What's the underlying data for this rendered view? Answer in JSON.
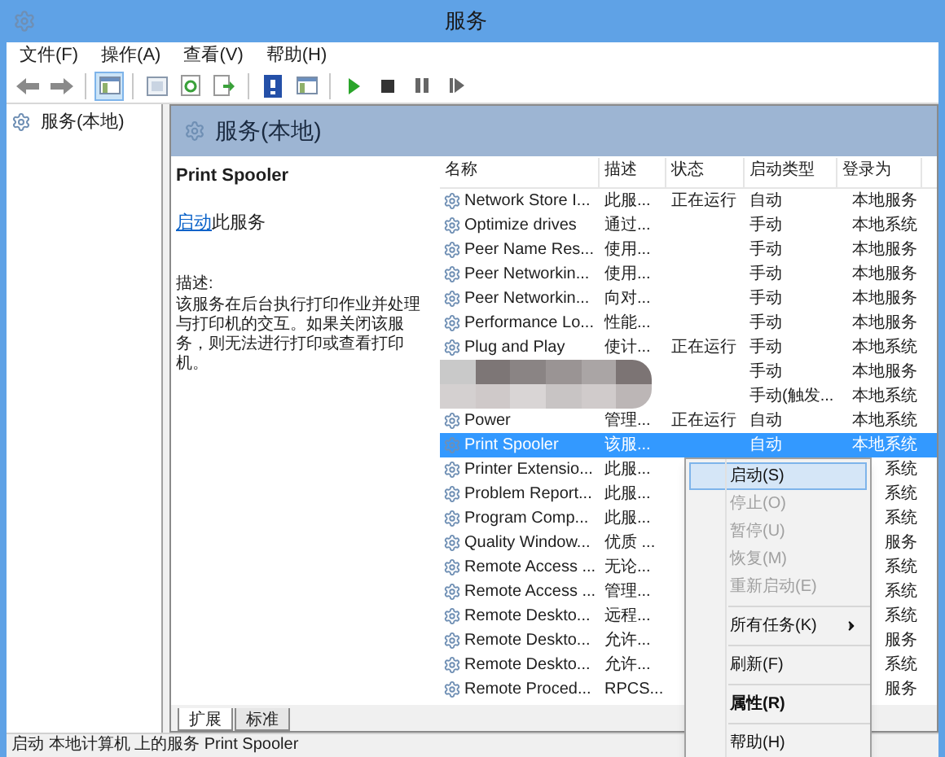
{
  "window": {
    "title": "服务"
  },
  "menu_bar": [
    "文件(F)",
    "操作(A)",
    "查看(V)",
    "帮助(H)"
  ],
  "toolbar": [
    {
      "kind": "back"
    },
    {
      "kind": "forward"
    },
    {
      "kind": "sep"
    },
    {
      "kind": "tree",
      "selected": true
    },
    {
      "kind": "sep"
    },
    {
      "kind": "props"
    },
    {
      "kind": "refresh"
    },
    {
      "kind": "export"
    },
    {
      "kind": "sep"
    },
    {
      "kind": "help"
    },
    {
      "kind": "console",
      "selected": false
    },
    {
      "kind": "sep"
    },
    {
      "kind": "play"
    },
    {
      "kind": "stop"
    },
    {
      "kind": "pause"
    },
    {
      "kind": "restart"
    }
  ],
  "tree": {
    "items": [
      {
        "label": "服务(本地)",
        "selected": false
      }
    ]
  },
  "panel": {
    "title": "服务(本地)"
  },
  "details": {
    "name": "Print Spooler",
    "action_link": "启动",
    "action_rest": "此服务",
    "description_label": "描述:",
    "description": "该服务在后台执行打印作业并处理与打印机的交互。如果关闭该服务，则无法进行打印或查看打印机。"
  },
  "table": {
    "columns": [
      "名称",
      "描述",
      "状态",
      "启动类型",
      "登录为"
    ],
    "rows": [
      {
        "name": "Network Store I...",
        "desc": "此服...",
        "status": "正在运行",
        "startup": "自动",
        "login": "本地服务",
        "selected": false
      },
      {
        "name": "Optimize drives",
        "desc": "通过...",
        "startup": "手动",
        "login": "本地系统",
        "selected": false
      },
      {
        "name": "Peer Name Res...",
        "desc": "使用...",
        "startup": "手动",
        "login": "本地服务",
        "selected": false
      },
      {
        "name": "Peer Networkin...",
        "desc": "使用...",
        "startup": "手动",
        "login": "本地服务",
        "selected": false
      },
      {
        "name": "Peer Networkin...",
        "desc": "向对...",
        "startup": "手动",
        "login": "本地服务",
        "selected": false
      },
      {
        "name": "Performance Lo...",
        "desc": "性能...",
        "startup": "手动",
        "login": "本地服务",
        "selected": false
      },
      {
        "name": "Plug and Play",
        "desc": "使计...",
        "status": "正在运行",
        "startup": "手动",
        "login": "本地系统",
        "selected": false
      },
      {
        "startup": "手动",
        "login": "本地服务",
        "selected": false
      },
      {
        "startup": "手动(触发...",
        "login": "本地系统",
        "selected": false
      },
      {
        "name": "Power",
        "desc": "管理...",
        "status": "正在运行",
        "startup": "自动",
        "login": "本地系统",
        "selected": false
      },
      {
        "name": "Print Spooler",
        "desc": "该服...",
        "startup": "自动",
        "login": "本地系统",
        "selected": true
      },
      {
        "name": "Printer Extensio...",
        "desc": "此服...",
        "login": "系统",
        "selected": false
      },
      {
        "name": "Problem Report...",
        "desc": "此服...",
        "login": "系统",
        "selected": false
      },
      {
        "name": "Program Comp...",
        "desc": "此服...",
        "login": "系统",
        "selected": false
      },
      {
        "name": "Quality Window...",
        "desc": "优质 ...",
        "login": "服务",
        "selected": false
      },
      {
        "name": "Remote Access ...",
        "desc": "无论...",
        "login": "系统",
        "selected": false
      },
      {
        "name": "Remote Access ...",
        "desc": "管理...",
        "login": "系统",
        "selected": false
      },
      {
        "name": "Remote Deskto...",
        "desc": "远程...",
        "login": "系统",
        "selected": false
      },
      {
        "name": "Remote Deskto...",
        "desc": "允许...",
        "login": "服务",
        "selected": false
      },
      {
        "name": "Remote Deskto...",
        "desc": "允许...",
        "login": "系统",
        "selected": false
      },
      {
        "name": "Remote Proced...",
        "desc": "RPCS...",
        "login": "服务",
        "selected": false
      }
    ]
  },
  "context_menu": {
    "items": [
      {
        "kind": "item",
        "label": "启动(S)",
        "disabled": false,
        "selected": true,
        "bold": false
      },
      {
        "kind": "item",
        "label": "停止(O)",
        "disabled": true,
        "selected": false,
        "bold": false
      },
      {
        "kind": "item",
        "label": "暂停(U)",
        "disabled": true,
        "selected": false,
        "bold": false
      },
      {
        "kind": "item",
        "label": "恢复(M)",
        "disabled": true,
        "selected": false,
        "bold": false
      },
      {
        "kind": "item",
        "label": "重新启动(E)",
        "disabled": true,
        "selected": false,
        "bold": false
      },
      {
        "kind": "sep"
      },
      {
        "kind": "submenu",
        "label": "所有任务(K)",
        "disabled": false,
        "selected": false,
        "bold": false
      },
      {
        "kind": "sep"
      },
      {
        "kind": "item",
        "label": "刷新(F)",
        "disabled": false,
        "selected": false,
        "bold": false
      },
      {
        "kind": "sep"
      },
      {
        "kind": "item",
        "label": "属性(R)",
        "disabled": false,
        "selected": false,
        "bold": true
      },
      {
        "kind": "sep"
      },
      {
        "kind": "item",
        "label": "帮助(H)",
        "disabled": false,
        "selected": false,
        "bold": false
      }
    ]
  },
  "bottom_tabs": [
    {
      "label": "扩展",
      "selected": true
    },
    {
      "label": "标准",
      "selected": false
    }
  ],
  "status_bar": "启动 本地计算机 上的服务 Print Spooler"
}
